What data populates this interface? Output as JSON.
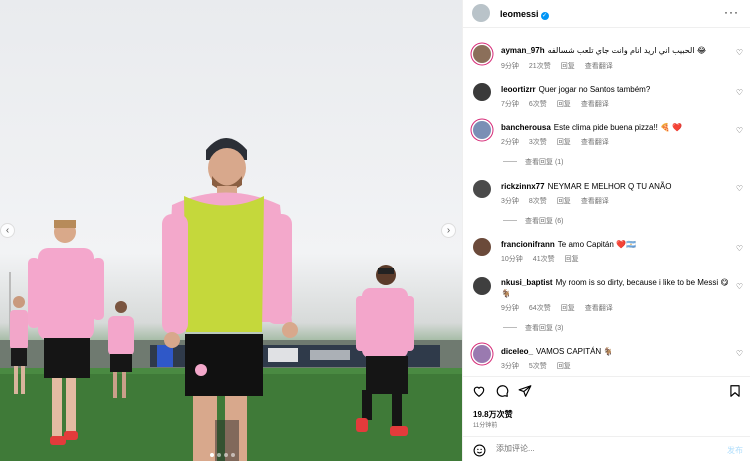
{
  "post": {
    "username": "leomessi",
    "verified": true,
    "likes": "19.8万次赞",
    "time_ago": "11分钟前",
    "add_comment_placeholder": "添加评论...",
    "post_label": "发布"
  },
  "comments": [
    {
      "username": "ayman_97h",
      "text": "الحبيب اني اريد انام وانت جاي تلعب شسالفه 😂",
      "time": "9分钟",
      "likes": "21次赞",
      "reply": "回复",
      "translate": "查看翻译"
    },
    {
      "username": "leoortizrr",
      "text": "Quer jogar no Santos também?",
      "time": "7分钟",
      "likes": "6次赞",
      "reply": "回复",
      "translate": "查看翻译"
    },
    {
      "username": "bancherousa",
      "text": "Este clima pide buena pizza!! 🍕 ❤️",
      "time": "2分钟",
      "likes": "3次赞",
      "reply": "回复",
      "translate": "查看翻译",
      "replies": "查看回复 (1)"
    },
    {
      "username": "rickzinnx77",
      "text": "NEYMAR E MELHOR Q TU ANÃO",
      "time": "3分钟",
      "likes": "8次赞",
      "reply": "回复",
      "translate": "查看翻译",
      "replies": "查看回复 (6)"
    },
    {
      "username": "francionifrann",
      "text": "Te amo Capitán ❤️🇦🇷",
      "time": "10分钟",
      "likes": "41次赞",
      "reply": "回复"
    },
    {
      "username": "nkusi_baptist",
      "text": "My room is so dirty, because i like to be Messi 😋 🐐",
      "time": "9分钟",
      "likes": "64次赞",
      "reply": "回复",
      "translate": "查看翻译",
      "replies": "查看回复 (3)"
    },
    {
      "username": "diceleo_",
      "text": "VAMOS CAPITÁN 🐐",
      "time": "3分钟",
      "likes": "5次赞",
      "reply": "回复"
    }
  ],
  "icons": [
    "heart-icon",
    "comment-icon",
    "share-icon",
    "bookmark-icon",
    "emoji-icon",
    "more-icon",
    "verified-icon",
    "chevron-left-icon",
    "chevron-right-icon"
  ],
  "colors": {
    "verified": "#0095f6",
    "meta": "#737373",
    "post_disabled": "#b2dffc",
    "story_ring": "#d62976"
  }
}
